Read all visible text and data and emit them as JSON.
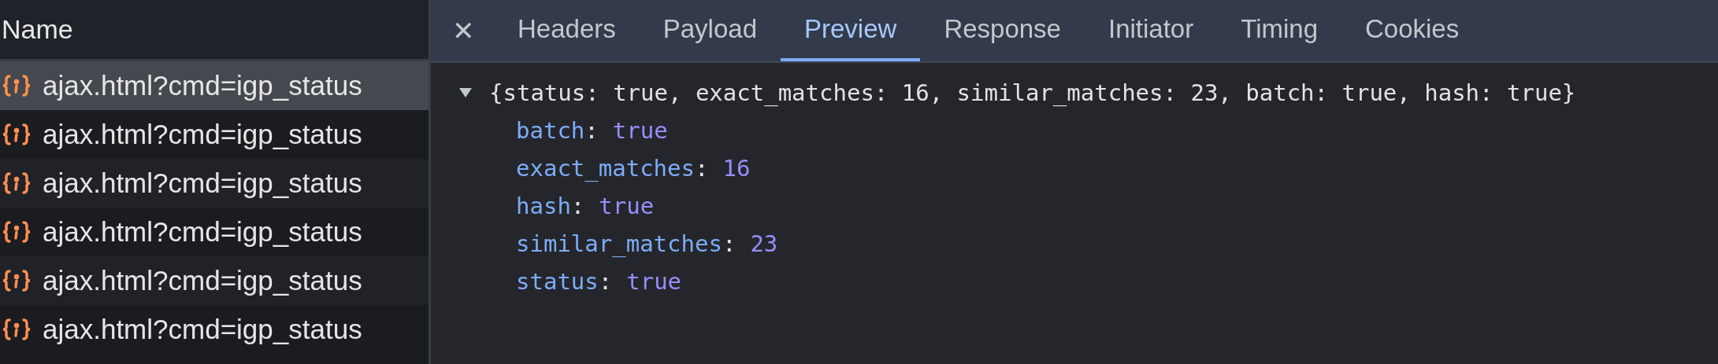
{
  "requests": {
    "column": "Name",
    "rows": [
      {
        "name": "ajax.html?cmd=igp_status",
        "selected": true
      },
      {
        "name": "ajax.html?cmd=igp_status",
        "selected": false
      },
      {
        "name": "ajax.html?cmd=igp_status",
        "selected": false
      },
      {
        "name": "ajax.html?cmd=igp_status",
        "selected": false
      },
      {
        "name": "ajax.html?cmd=igp_status",
        "selected": false
      },
      {
        "name": "ajax.html?cmd=igp_status",
        "selected": false
      }
    ]
  },
  "close_symbol": "✕",
  "tabs": [
    {
      "label": "Headers",
      "selected": false
    },
    {
      "label": "Payload",
      "selected": false
    },
    {
      "label": "Preview",
      "selected": true
    },
    {
      "label": "Response",
      "selected": false
    },
    {
      "label": "Initiator",
      "selected": false
    },
    {
      "label": "Timing",
      "selected": false
    },
    {
      "label": "Cookies",
      "selected": false
    }
  ],
  "preview": {
    "summary": "{status: true, exact_matches: 16, similar_matches: 23, batch: true, hash: true}",
    "expanded": true,
    "properties": [
      {
        "key": "batch",
        "separator": ":",
        "value": "true"
      },
      {
        "key": "exact_matches",
        "separator": ":",
        "value": "16"
      },
      {
        "key": "hash",
        "separator": ":",
        "value": "true"
      },
      {
        "key": "similar_matches",
        "separator": ":",
        "value": "23"
      },
      {
        "key": "status",
        "separator": ":",
        "value": "true"
      }
    ]
  }
}
